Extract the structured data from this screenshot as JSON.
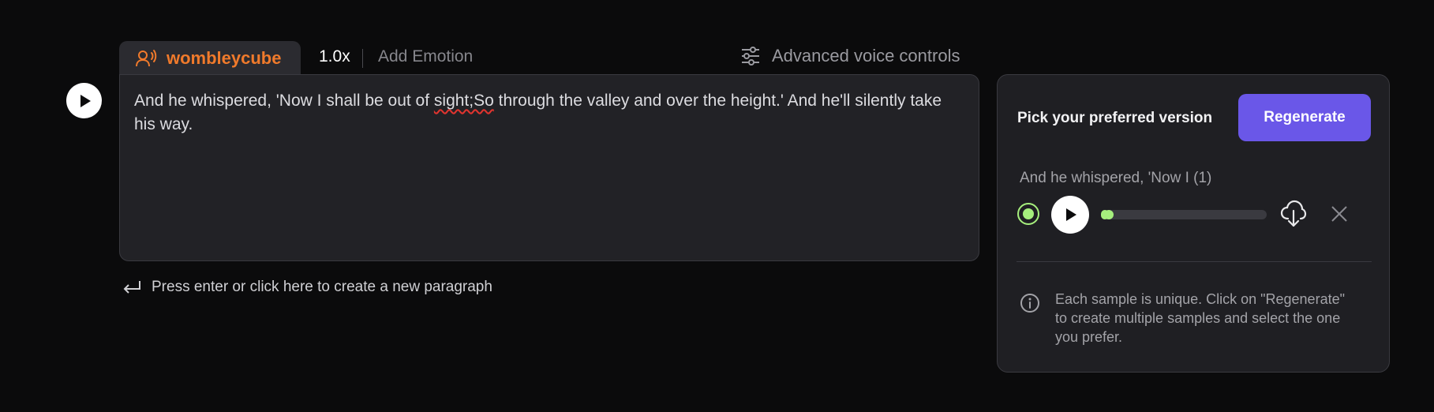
{
  "voice": {
    "name": "wombleycube",
    "icon": "voice-user-icon"
  },
  "speed": "1.0x",
  "emotion_label": "Add Emotion",
  "advanced_label": "Advanced voice controls",
  "editor": {
    "text_before": "And he whispered, 'Now I shall be out of ",
    "text_misspelled": "sight;So",
    "text_after": " through the valley and over the height.' And he'll silently take his way."
  },
  "new_paragraph_hint": "Press enter or click here to create a new paragraph",
  "panel": {
    "pick_label": "Pick your preferred version",
    "regenerate_label": "Regenerate",
    "samples": [
      {
        "title": "And he whispered, 'Now I (1)",
        "selected": true,
        "progress": 0.02
      }
    ],
    "info_text": "Each sample is unique. Click on \"Regenerate\" to create multiple samples and select the one you prefer."
  },
  "colors": {
    "accent_orange": "#f07a2b",
    "accent_purple": "#6a57e8",
    "accent_green": "#a6ef7d",
    "background": "#0b0b0c"
  }
}
